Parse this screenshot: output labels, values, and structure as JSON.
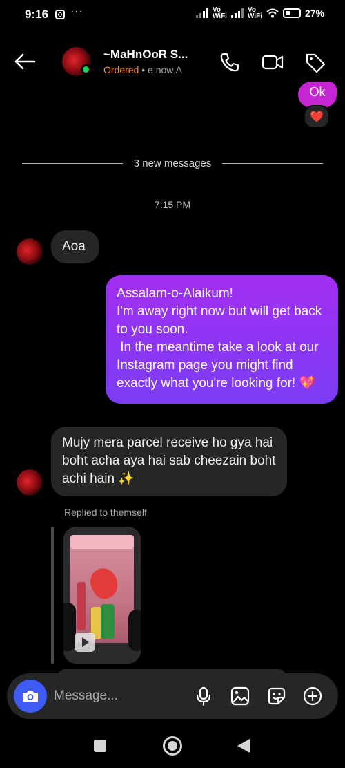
{
  "status_bar": {
    "time": "9:16",
    "more": "···",
    "vowifi_1": "Vo\nWiFi",
    "vowifi_2": "Vo\nWiFi",
    "battery": "27%"
  },
  "header": {
    "contact_name": "~MaHnOoR S...",
    "ordered_label": "Ordered",
    "sub_rest": " • e now   A"
  },
  "messages": {
    "ok_text": "Ok",
    "reaction": "❤️",
    "new_messages_label": "3 new messages",
    "timestamp": "7:15 PM",
    "aoa": "Aoa",
    "auto_reply": "Assalam-o-Alaikum!\nI'm away right now but will get back to you soon.\n In the meantime take a look at our Instagram page you might find exactly what you're looking for! 💖",
    "parcel_message": "Mujy mera parcel receive ho gya hai boht acha aya hai sab cheezain boht achi hain ✨",
    "replied_label": "Replied to themself"
  },
  "composer": {
    "placeholder": "Message..."
  },
  "colors": {
    "accent_blue": "#3e5bf6",
    "ordered_orange": "#ff8a1f",
    "bubble_gray": "#262626",
    "gradient_purple": "#a32ef3"
  }
}
